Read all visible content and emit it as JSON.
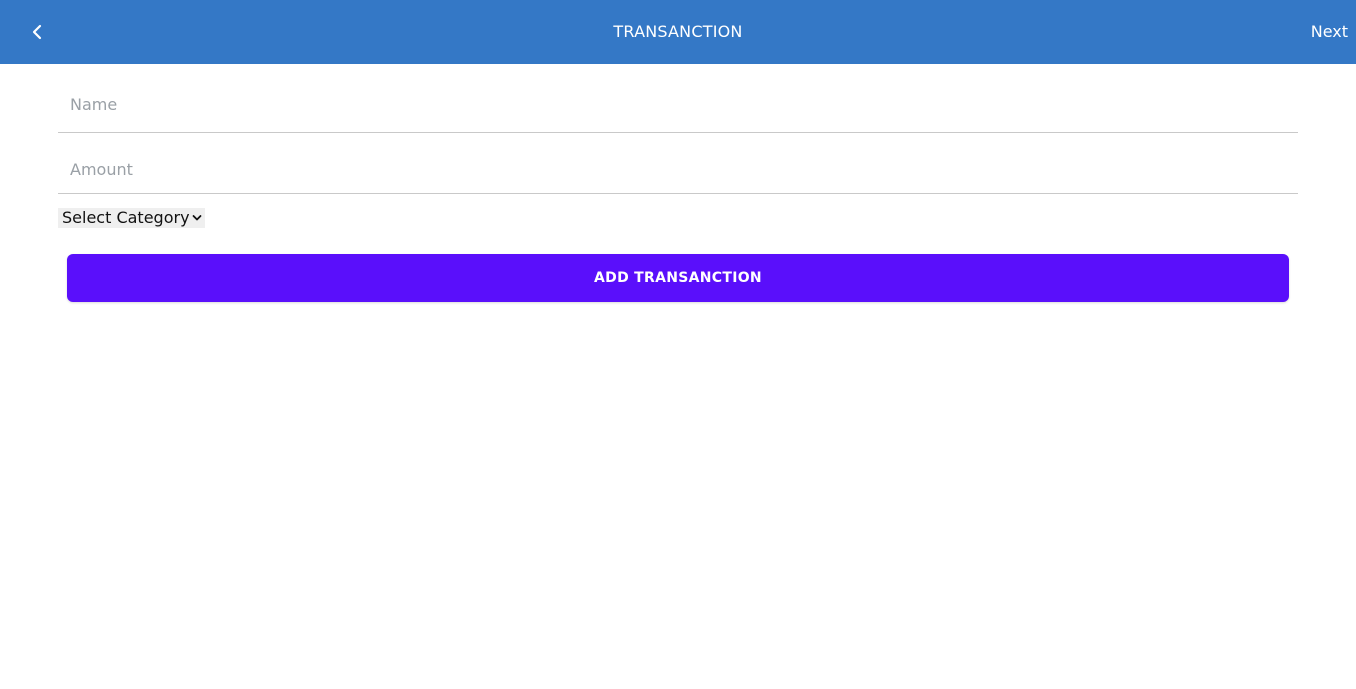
{
  "header": {
    "title": "TRANSANCTION",
    "back_icon": "chevron-left-icon",
    "next_label": "Next",
    "background_color": "#3478c6"
  },
  "form": {
    "name": {
      "value": "",
      "placeholder": "Name"
    },
    "amount": {
      "value": "",
      "placeholder": "Amount"
    },
    "category": {
      "selected": "Select Category",
      "icon": "chevron-down-icon"
    },
    "submit": {
      "label": "ADD TRANSANCTION",
      "color": "#5a0ffb"
    }
  }
}
